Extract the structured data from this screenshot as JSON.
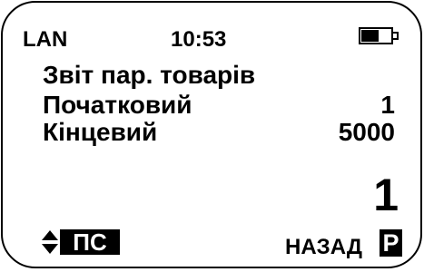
{
  "status_bar": {
    "network": "LAN",
    "time": "10:53",
    "battery_icon": "battery-icon",
    "battery_level_fraction": 0.6
  },
  "report": {
    "title": "Звіт пар. товарів",
    "rows": [
      {
        "label": "Початковий",
        "value": "1"
      },
      {
        "label": "Кінцевий",
        "value": "5000"
      }
    ],
    "entry_value": "1"
  },
  "softkeys": {
    "left_icon": "up-down-arrows-icon",
    "left_label": "ПС",
    "right_text": "НАЗАД",
    "right_label": "Р"
  },
  "colors": {
    "foreground": "#000000",
    "background": "#ffffff"
  }
}
